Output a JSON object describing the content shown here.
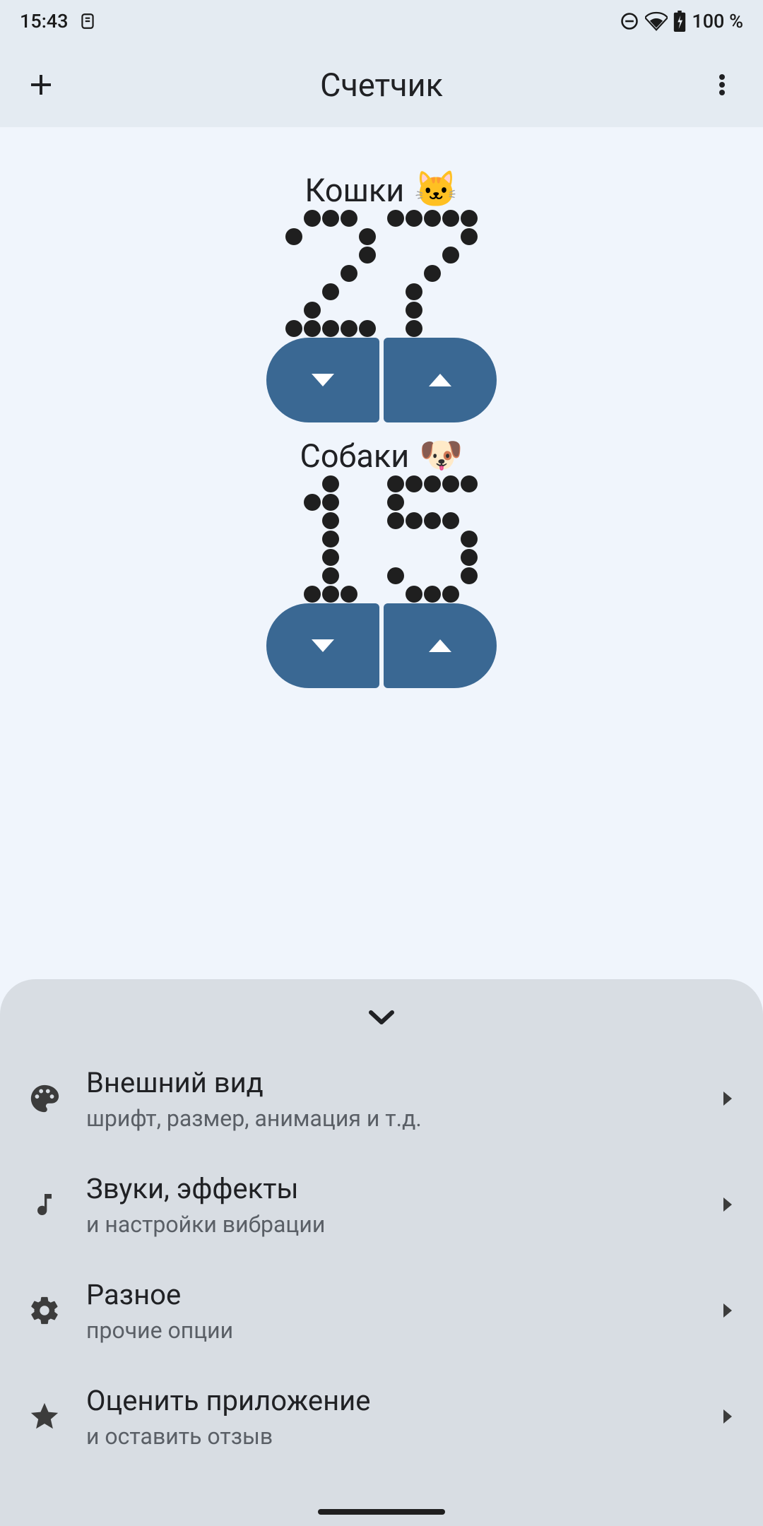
{
  "status": {
    "time": "15:43",
    "battery": "100 %"
  },
  "appbar": {
    "title": "Счетчик"
  },
  "counters": [
    {
      "label": "Кошки",
      "emoji": "🐱",
      "value": 27
    },
    {
      "label": "Собаки",
      "emoji": "🐶",
      "value": 15
    }
  ],
  "sheet": {
    "items": [
      {
        "icon": "palette",
        "title": "Внешний вид",
        "sub": "шрифт, размер, анимация и т.д."
      },
      {
        "icon": "music-note",
        "title": "Звуки, эффекты",
        "sub": "и настройки вибрации"
      },
      {
        "icon": "gear",
        "title": "Разное",
        "sub": "прочие опции"
      },
      {
        "icon": "star",
        "title": "Оценить приложение",
        "sub": "и оставить отзыв"
      }
    ]
  }
}
